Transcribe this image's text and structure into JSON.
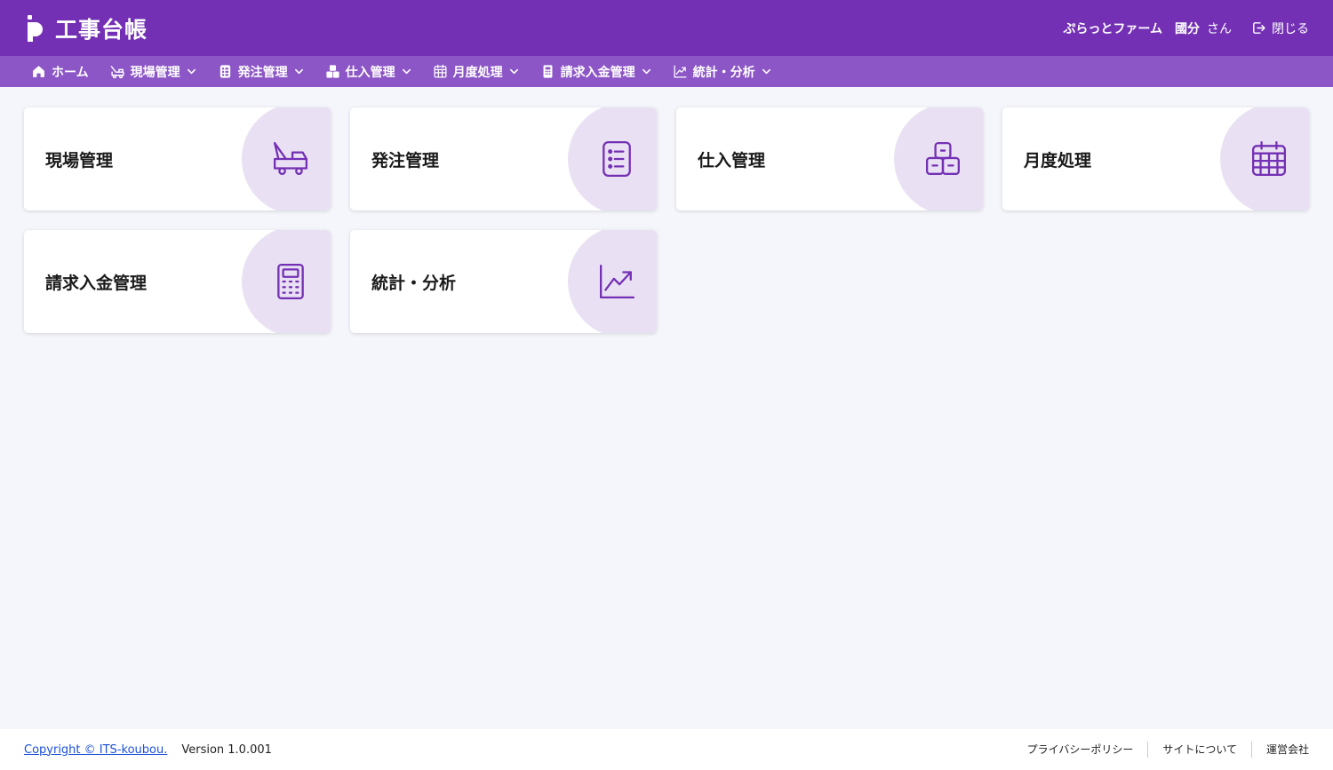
{
  "header": {
    "app_title": "工事台帳",
    "logo_icon": "p-logo-icon",
    "company": "ぷらっとファーム",
    "user_name": "國分",
    "honorific": "さん",
    "close_label": "閉じる",
    "close_icon": "logout-icon",
    "bg_color": "#7430b4"
  },
  "nav": {
    "bg_color": "#8c56c6",
    "items": [
      {
        "label": "ホーム",
        "icon": "home-icon",
        "dropdown": false
      },
      {
        "label": "現場管理",
        "icon": "site-icon",
        "dropdown": true
      },
      {
        "label": "発注管理",
        "icon": "order-icon",
        "dropdown": true
      },
      {
        "label": "仕入管理",
        "icon": "boxes-icon",
        "dropdown": true
      },
      {
        "label": "月度処理",
        "icon": "calendar-icon",
        "dropdown": true
      },
      {
        "label": "請求入金管理",
        "icon": "calculator-icon",
        "dropdown": true
      },
      {
        "label": "統計・分析",
        "icon": "chart-icon",
        "dropdown": true
      }
    ]
  },
  "cards": [
    {
      "label": "現場管理",
      "icon": "site-icon"
    },
    {
      "label": "発注管理",
      "icon": "order-list-icon"
    },
    {
      "label": "仕入管理",
      "icon": "boxes-icon"
    },
    {
      "label": "月度処理",
      "icon": "calendar-icon"
    },
    {
      "label": "請求入金管理",
      "icon": "calculator-icon"
    },
    {
      "label": "統計・分析",
      "icon": "chart-icon"
    }
  ],
  "accent_color": "#7430b4",
  "footer": {
    "copyright": "Copyright © ITS-koubou.",
    "version": "Version 1.0.001",
    "links": [
      "プライバシーポリシー",
      "サイトについて",
      "運営会社"
    ]
  }
}
